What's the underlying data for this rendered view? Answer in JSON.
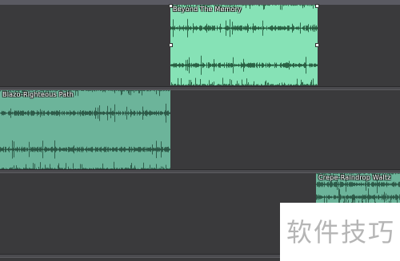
{
  "tracks": [
    {
      "clip": {
        "title": "Beyond The Memory",
        "color": "#86e2b6",
        "wave_color": "#1a4a30",
        "selected": true
      }
    },
    {
      "clip": {
        "title": "Blazo-Righteous Path",
        "color": "#6cb49a",
        "wave_color": "#234a3a",
        "selected": false
      }
    },
    {
      "clip": {
        "title": "Crepe-Raindrop Waltz",
        "color": "#6cb49a",
        "wave_color": "#234a3a",
        "selected": false
      }
    }
  ],
  "watermark": {
    "text": "软件技巧"
  }
}
